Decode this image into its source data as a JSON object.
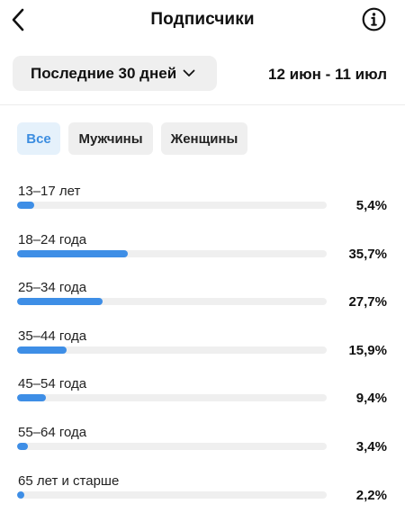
{
  "header": {
    "title": "Подписчики"
  },
  "period": {
    "label": "Последние 30 дней",
    "date_range": "12 июн - 11 июл"
  },
  "filters": [
    {
      "label": "Все",
      "active": true
    },
    {
      "label": "Мужчины",
      "active": false
    },
    {
      "label": "Женщины",
      "active": false
    }
  ],
  "age_groups": [
    {
      "label": "13–17 лет",
      "value": "5,4%",
      "percent": 5.4
    },
    {
      "label": "18–24 года",
      "value": "35,7%",
      "percent": 35.7
    },
    {
      "label": "25–34 года",
      "value": "27,7%",
      "percent": 27.7
    },
    {
      "label": "35–44 года",
      "value": "15,9%",
      "percent": 15.9
    },
    {
      "label": "45–54 года",
      "value": "9,4%",
      "percent": 9.4
    },
    {
      "label": "55–64 года",
      "value": "3,4%",
      "percent": 3.4
    },
    {
      "label": "65 лет и старше",
      "value": "2,2%",
      "percent": 2.2
    }
  ],
  "colors": {
    "accent": "#3e8ee6",
    "chip_active_bg": "#e5f1fb",
    "chip_bg": "#efefef",
    "track": "#efefef"
  },
  "icons": {
    "back": "chevron-left-icon",
    "info": "info-icon",
    "dropdown": "chevron-down-icon"
  }
}
